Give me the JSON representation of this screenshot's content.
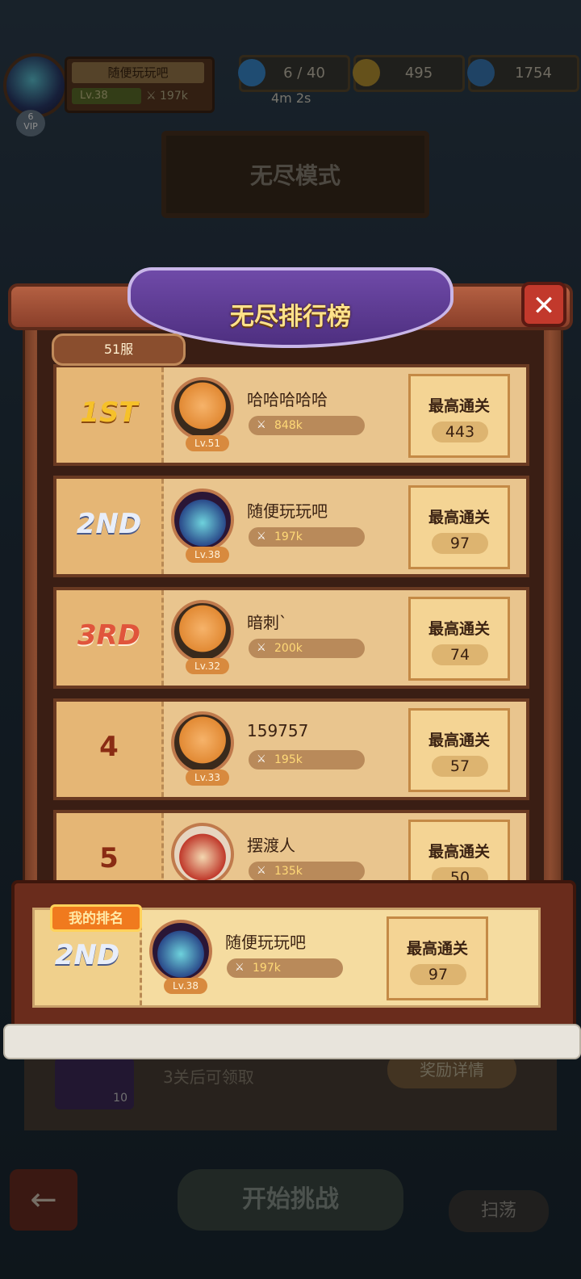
{
  "hud": {
    "player_name": "随便玩玩吧",
    "player_level": "Lv.38",
    "player_power": "197k",
    "vip_level": "6",
    "vip_label": "VIP",
    "stars": "6 / 40",
    "gold": "495",
    "gems": "1754",
    "timer": "4m 2s"
  },
  "mode_title": "无尽模式",
  "leaderboard": {
    "title": "无尽排行榜",
    "server": "51服",
    "best_label": "最高通关",
    "entries": [
      {
        "rank": "1ST",
        "name": "哈哈哈哈哈",
        "level": "Lv.51",
        "power": "848k",
        "best": "443",
        "avatar": "orange-hair-hero"
      },
      {
        "rank": "2ND",
        "name": "随便玩玩吧",
        "level": "Lv.38",
        "power": "197k",
        "best": "97",
        "avatar": "witch-hero"
      },
      {
        "rank": "3RD",
        "name": "暗刺`",
        "level": "Lv.32",
        "power": "200k",
        "best": "74",
        "avatar": "orange-hair-hero"
      },
      {
        "rank": "4",
        "name": "159757",
        "level": "Lv.33",
        "power": "195k",
        "best": "57",
        "avatar": "orange-hair-hero"
      },
      {
        "rank": "5",
        "name": "摆渡人",
        "level": "",
        "power": "135k",
        "best": "50",
        "avatar": "hooded-rogue"
      }
    ],
    "my_rank": {
      "tag": "我的排名",
      "rank": "2ND",
      "name": "随便玩玩吧",
      "level": "Lv.38",
      "power": "197k",
      "best": "97"
    }
  },
  "reward": {
    "text": "3关后可领取",
    "count": "10",
    "details_button": "奖励详情"
  },
  "bottom": {
    "back_icon": "←",
    "start_button": "开始挑战",
    "sweep_button": "扫荡"
  },
  "colors": {
    "rank1": "#f6c12a",
    "rank2": "#8fa6d8",
    "rank3": "#e0553c",
    "rank_plain": "#8a2c14",
    "power_text": "#ffd977",
    "close_button": "#c2392c",
    "my_rank_tag": "#f07a1e"
  }
}
